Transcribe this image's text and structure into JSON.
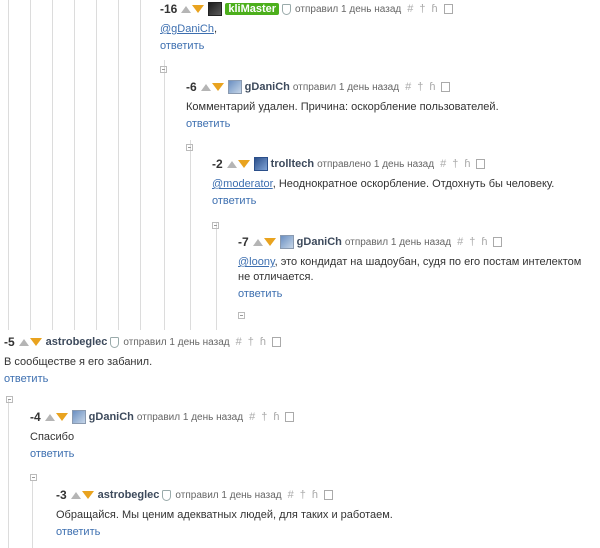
{
  "comments": [
    {
      "score": "-16",
      "user": "kliMaster",
      "meta": "отправил 1 день назад",
      "mention": "@gDaniCh",
      "text": ",",
      "reply": "ответить"
    },
    {
      "score": "-6",
      "user": "gDaniCh",
      "meta": "отправил 1 день назад",
      "text": "Комментарий удален. Причина: оскорбление пользователей.",
      "reply": "ответить"
    },
    {
      "score": "-2",
      "user": "trolltech",
      "meta": "отправлено 1 день назад",
      "mention": "@moderator",
      "text": ", Неоднократное оскорбление. Отдохнуть бы человеку.",
      "reply": "ответить"
    },
    {
      "score": "-7",
      "user": "gDaniCh",
      "meta": "отправил 1 день назад",
      "mention": "@loony",
      "text": ", это кондидат на шадоубан, судя по его постам интелектом не отличается.",
      "reply": "ответить"
    },
    {
      "score": "-5",
      "user": "astrobeglec",
      "meta": "отправил 1 день назад",
      "text": "В сообществе я его забанил.",
      "reply": "ответить"
    },
    {
      "score": "-4",
      "user": "gDaniCh",
      "meta": "отправил 1 день назад",
      "text": "Спасибо",
      "reply": "ответить"
    },
    {
      "score": "-3",
      "user": "astrobeglec",
      "meta": "отправил 1 день назад",
      "text": "Обращайся. Мы ценим адекватных людей, для таких и работаем.",
      "reply": "ответить"
    }
  ],
  "actions": {
    "link": "#",
    "parent": "†",
    "thread": "ɦ"
  }
}
